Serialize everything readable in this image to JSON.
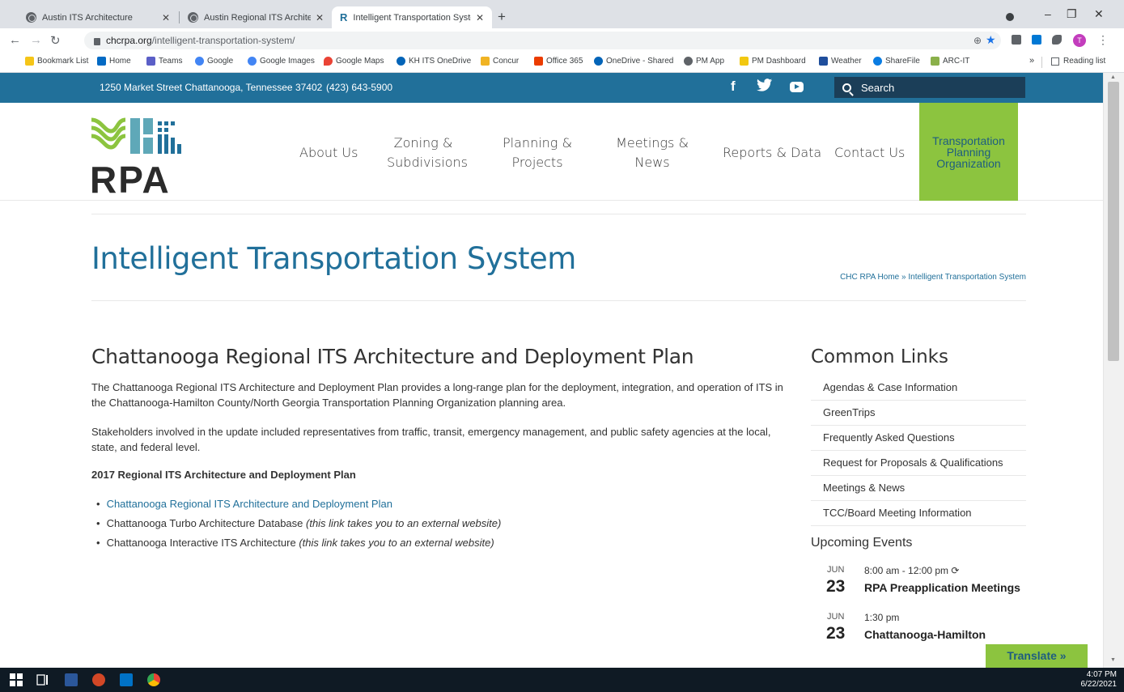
{
  "browser": {
    "tabs": [
      {
        "title": "Austin ITS Architecture",
        "active": false
      },
      {
        "title": "Austin Regional ITS Architecture",
        "active": false
      },
      {
        "title": "Intelligent Transportation System",
        "active": true
      }
    ],
    "url_host": "chcrpa.org",
    "url_path": "/intelligent-transportation-system/",
    "profile_initial": "T",
    "bookmarks": [
      "Bookmark List",
      "Home",
      "Teams",
      "Google",
      "Google Images",
      "Google Maps",
      "KH ITS OneDrive",
      "Concur",
      "Office 365",
      "OneDrive - Shared",
      "PM App",
      "PM Dashboard",
      "Weather",
      "ShareFile",
      "ARC-IT"
    ],
    "reading_list": "Reading list"
  },
  "topbar": {
    "address": "1250 Market Street Chattanooga, Tennessee 37402",
    "phone": "(423) 643-5900",
    "search_label": "Search"
  },
  "logo": {
    "text": "RPA"
  },
  "nav": {
    "about": "About Us",
    "zoning_1": "Zoning &",
    "zoning_2": "Subdivisions",
    "planning_1": "Planning &",
    "planning_2": "Projects",
    "meetings_1": "Meetings &",
    "meetings_2": "News",
    "reports": "Reports & Data",
    "contact": "Contact Us",
    "tpo_1": "Transportation",
    "tpo_2": "Planning",
    "tpo_3": "Organization"
  },
  "page": {
    "title": "Intelligent Transportation System",
    "breadcrumb_home": "CHC RPA Home",
    "breadcrumb_sep": " » ",
    "breadcrumb_current": "Intelligent Transportation System"
  },
  "content": {
    "heading": "Chattanooga Regional ITS Architecture and Deployment Plan",
    "para1": "The Chattanooga Regional ITS Architecture and Deployment Plan provides a long-range plan for the deployment, integration, and operation of ITS in the Chattanooga-Hamilton County/North Georgia Transportation Planning Organization planning area.",
    "para2": "Stakeholders involved in the update included representatives from traffic, transit, emergency management, and public safety agencies at the local, state, and federal level.",
    "subheading": "2017 Regional ITS Architecture and Deployment Plan",
    "links": [
      {
        "text": "Chattanooga Regional ITS Architecture and Deployment Plan",
        "note": ""
      },
      {
        "text": "Chattanooga Turbo Architecture Database ",
        "note": "(this link takes you to an external website)"
      },
      {
        "text": "Chattanooga Interactive ITS Architecture ",
        "note": "(this link takes you to an external website)"
      }
    ]
  },
  "sidebar": {
    "heading": "Common Links",
    "links": [
      "Agendas & Case Information",
      "GreenTrips",
      "Frequently Asked Questions",
      "Request for Proposals & Qualifications",
      "Meetings & News",
      "TCC/Board Meeting Information"
    ],
    "events_heading": "Upcoming Events",
    "events": [
      {
        "month": "JUN",
        "day": "23",
        "time": "8:00 am - 12:00 pm",
        "title": "RPA Preapplication Meetings"
      },
      {
        "month": "JUN",
        "day": "23",
        "time": "1:30 pm",
        "title": "Chattanooga-Hamilton"
      }
    ]
  },
  "translate": "Translate »",
  "taskbar": {
    "time": "4:07 PM",
    "date": "6/22/2021"
  },
  "colors": {
    "brand_blue": "#21709a",
    "brand_green": "#8cc43f",
    "search_bg": "#1b3e58"
  }
}
